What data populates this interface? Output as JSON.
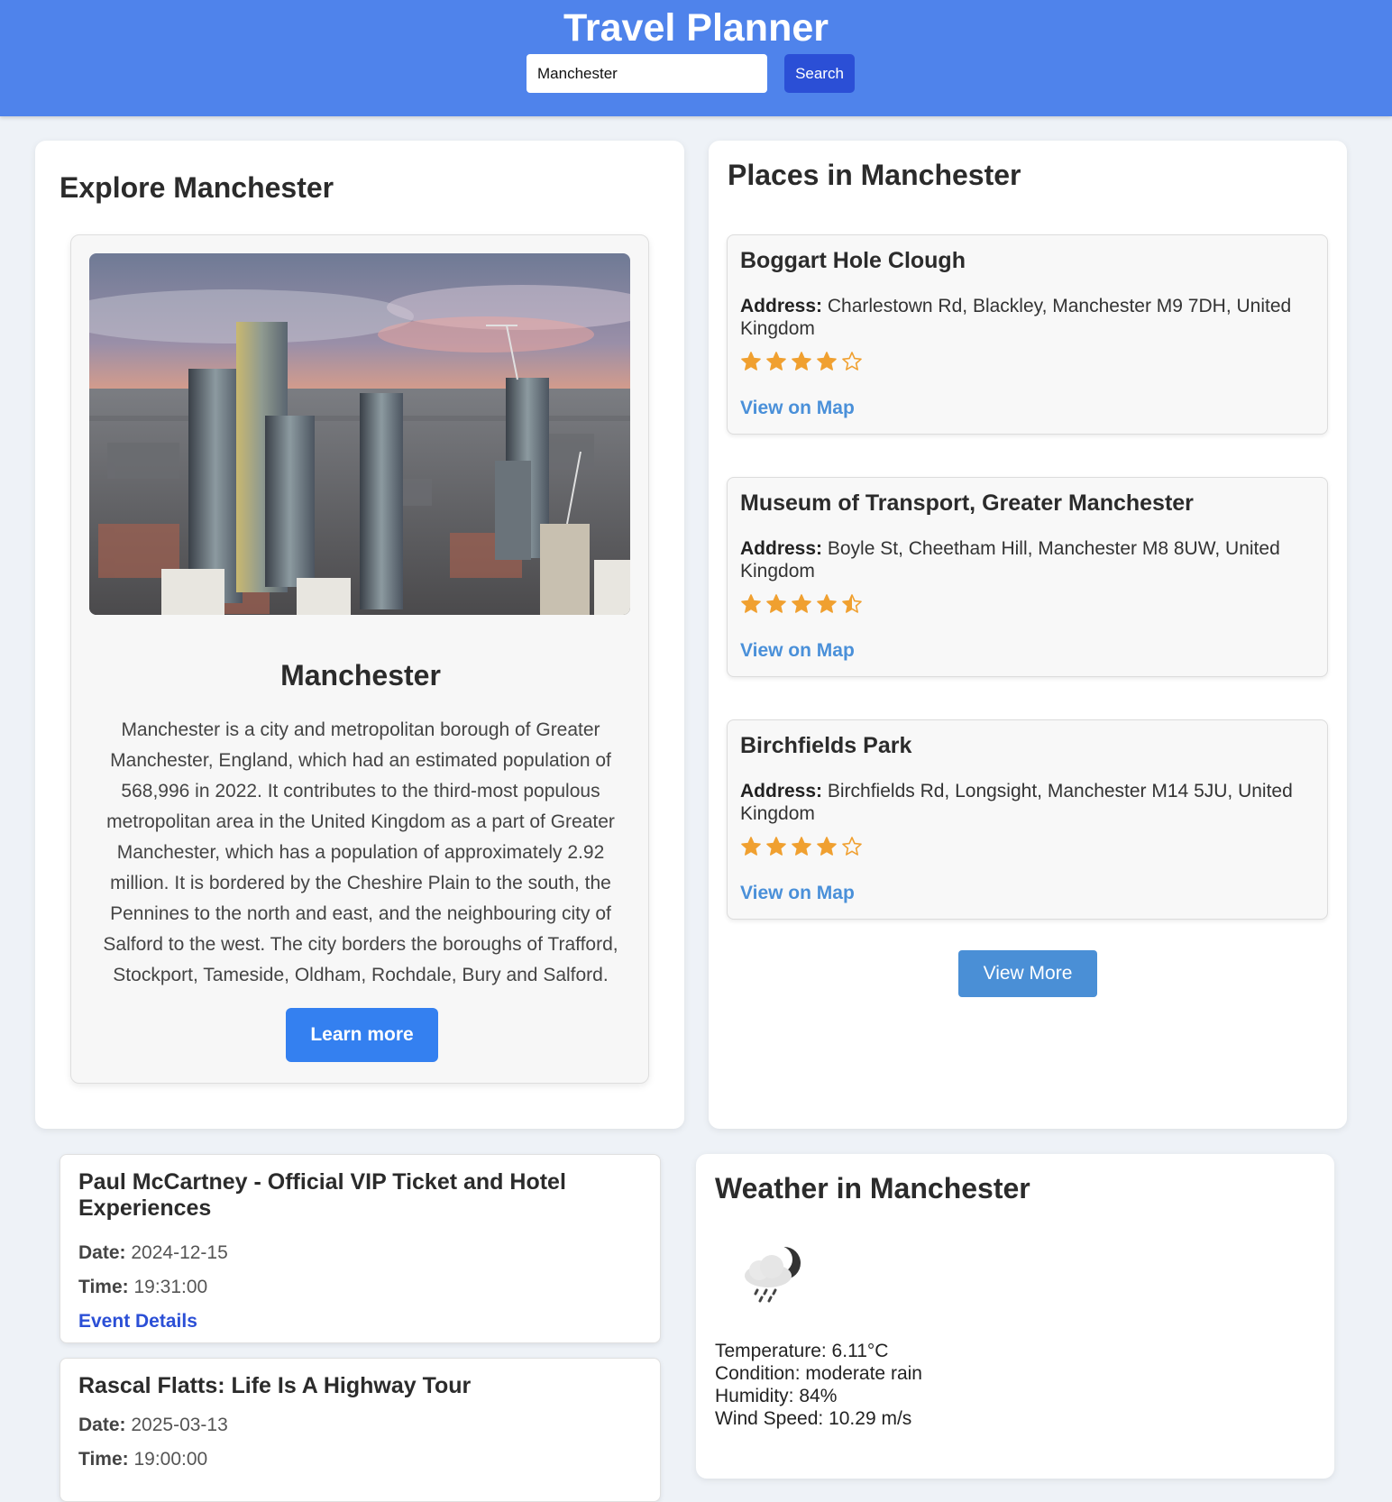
{
  "header": {
    "title": "Travel Planner",
    "search_value": "Manchester",
    "search_button": "Search"
  },
  "explore": {
    "title": "Explore Manchester",
    "city_name": "Manchester",
    "description": "Manchester is a city and metropolitan borough of Greater Manchester, England, which had an estimated population of 568,996 in 2022. It contributes to the third-most populous metropolitan area in the United Kingdom as a part of Greater Manchester, which has a population of approximately 2.92 million. It is bordered by the Cheshire Plain to the south, the Pennines to the north and east, and the neighbouring city of Salford to the west. The city borders the boroughs of Trafford, Stockport, Tameside, Oldham, Rochdale, Bury and Salford.",
    "learn_more": "Learn more"
  },
  "places": {
    "title": "Places in Manchester",
    "address_label": "Address:",
    "view_on_map": "View on Map",
    "view_more": "View More",
    "items": [
      {
        "name": "Boggart Hole Clough",
        "address": "Charlestown Rd, Blackley, Manchester M9 7DH, United Kingdom",
        "rating": 4
      },
      {
        "name": "Museum of Transport, Greater Manchester",
        "address": "Boyle St, Cheetham Hill, Manchester M8 8UW, United Kingdom",
        "rating": 4.5
      },
      {
        "name": "Birchfields Park",
        "address": "Birchfields Rd, Longsight, Manchester M14 5JU, United Kingdom",
        "rating": 4
      }
    ]
  },
  "events": {
    "date_label": "Date:",
    "time_label": "Time:",
    "details_label": "Event Details",
    "items": [
      {
        "title": "Paul McCartney - Official VIP Ticket and Hotel Experiences",
        "date": "2024-12-15",
        "time": "19:31:00"
      },
      {
        "title": "Rascal Flatts: Life Is A Highway Tour",
        "date": "2025-03-13",
        "time": "19:00:00"
      }
    ]
  },
  "weather": {
    "title": "Weather in Manchester",
    "icon": "night-rain-cloud-icon",
    "temperature": "Temperature: 6.11°C",
    "condition": "Condition: moderate rain",
    "humidity": "Humidity: 84%",
    "wind": "Wind Speed: 10.29 m/s"
  },
  "colors": {
    "header": "#4f83eb",
    "search_button": "#2b4fd6",
    "learn_more": "#3480f0",
    "link": "#4a90d9",
    "star": "#f0a030"
  }
}
